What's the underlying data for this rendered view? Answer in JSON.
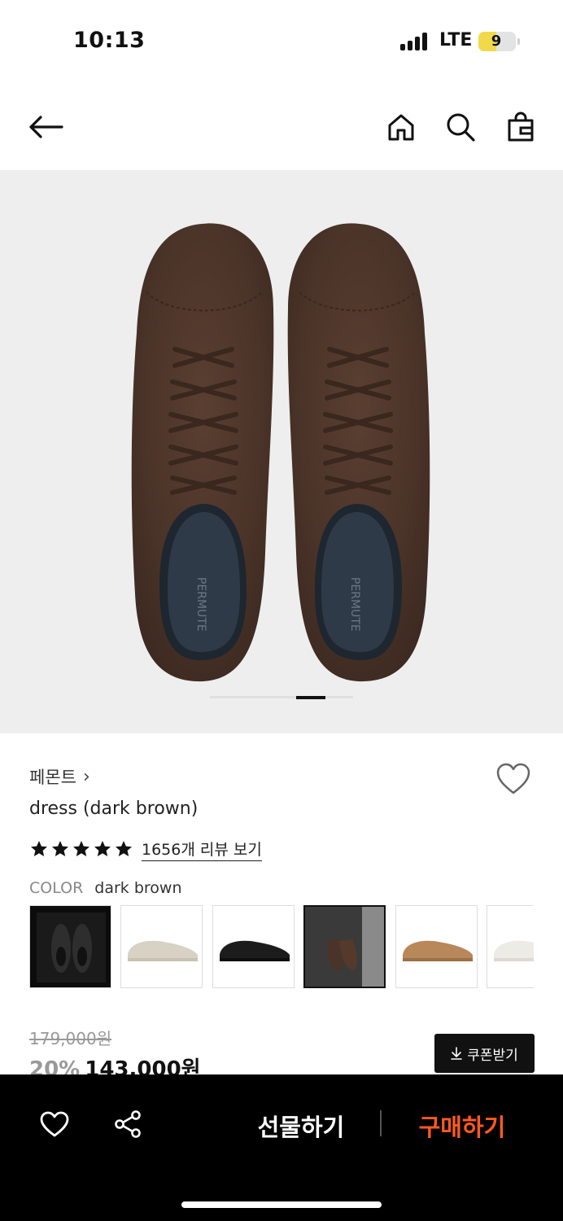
{
  "status_bar": {
    "time": "10:13",
    "network": "LTE",
    "battery": "9"
  },
  "nav": {
    "back_icon": "arrow-left-icon",
    "home_icon": "home-icon",
    "search_icon": "search-icon",
    "bag_icon": "shopping-bag-icon"
  },
  "carousel": {
    "image_icon": "suede-sneakers-top-view",
    "insole_text": "PERMUTE"
  },
  "product": {
    "brand": "페몬트",
    "brand_chevron": "›",
    "name": "dress (dark brown)",
    "rating_stars": 5,
    "review_link": "1656개 리뷰 보기",
    "color_label": "COLOR",
    "color_value": "dark brown"
  },
  "swatches": [
    {
      "name": "black-box",
      "selected": false
    },
    {
      "name": "beige",
      "selected": false
    },
    {
      "name": "black",
      "selected": false
    },
    {
      "name": "dark-brown",
      "selected": true
    },
    {
      "name": "camel",
      "selected": false
    },
    {
      "name": "white",
      "selected": false
    }
  ],
  "price": {
    "original": "179,000원",
    "discount": "20%",
    "final": "143,000원",
    "coupon_button": "쿠폰받기"
  },
  "bottom_bar": {
    "gift_button": "선물하기",
    "buy_button": "구매하기"
  },
  "colors": {
    "accent": "#ff5a1f",
    "shoe_brown": "#4a3328"
  }
}
